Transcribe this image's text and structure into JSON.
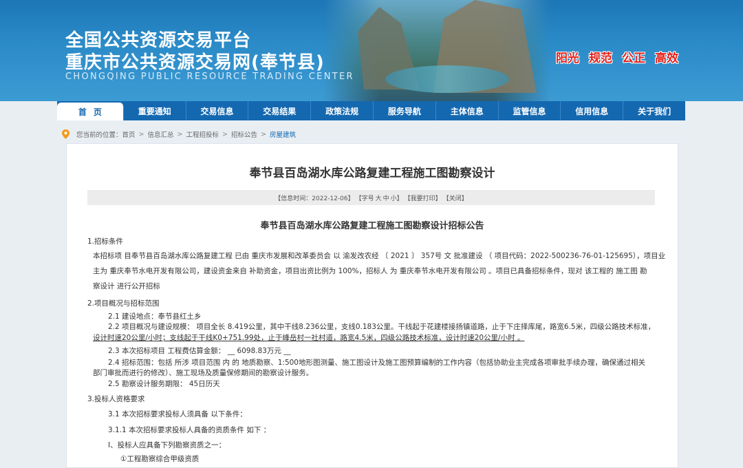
{
  "header": {
    "title_line1": "全国公共资源交易平台",
    "title_line2": "重庆市公共资源交易网(奉节县)",
    "title_en": "CHONGQING PUBLIC RESOURCE TRADING CENTER",
    "slogans": [
      "阳光",
      "规范",
      "公正",
      "高效"
    ],
    "slogan_color": "#e4201b"
  },
  "nav": {
    "items": [
      "首页",
      "重要通知",
      "交易信息",
      "交易结果",
      "政策法规",
      "服务导航",
      "主体信息",
      "监管信息",
      "信用信息",
      "关于我们"
    ],
    "active": "首页",
    "bg_color": "#1468b0"
  },
  "breadcrumb": {
    "prefix": "您当前的位置：",
    "items": [
      "首页",
      "信息汇总",
      "工程招投标",
      "招标公告"
    ],
    "current": "房屋建筑",
    "sep": ">"
  },
  "article": {
    "title": "奉节县百岛湖水库公路复建工程施工图勘察设计",
    "info": {
      "date": "【信息时间：2022-12-06】",
      "font_size_label": "【字号",
      "size_large": "大",
      "size_medium": "中",
      "size_small": "小】",
      "print": "【我要打印】",
      "close": "【关闭】"
    },
    "notice_title": "奉节县百岛湖水库公路复建工程施工图勘察设计招标公告",
    "lines": [
      "1.招标条件",
      "本招标项 目奉节县百岛湖水库公路复建工程 已由 重庆市发展和改革委员会 以 渝发改农经 〔 2021 〕 357号 文 批准建设 （ 项目代码：2022-500236-76-01-125695），项目业",
      "主为 重庆奉节水电开发有限公司，建设资金来自 补助资金，项目出资比例为 100%，招标人 为 重庆奉节水电开发有限公司 。项目已具备招标条件，现对 该工程的 施工图 勘",
      "察设计 进行公开招标",
      "2.项目概况与招标范围",
      "2.1 建设地点：奉节县红土乡",
      "2.2 项目概况与建设规模： 项目全长 8.419公里，其中干线8.236公里，支线0.183公里。干线起于花建楼接扬镇道路，止于下庄择库尾，路宽6.5米，四级公路技术标准，",
      "设计时速20公里/小时；支线起于干线K0+751.99处，止于峰岳村一社村道，路宽4.5米，四级公路技术标准，设计时速20公里/小时 。",
      "2.3 本次招标项目 工程费估算金额：  __ 6098.83万元 __",
      "2.4 招标范围：包括 所涉 项目范围 内 的 地质勘察、1:500地形图测量、施工图设计及施工图预算编制的工作内容（包括协助业主完成各项审批手续办理，确保通过相关",
      "部门审批而进行的修改）、施工现场及质量保修期间的勘察设计服务。",
      "2.5 勘察设计服务期限： 45日历天",
      "3.投标人资格要求",
      "3.1   本次招标要求投标人须具备 以下条件：",
      "3.1.1 本次招标要求投标人具备的资质条件 如下 ：",
      "I、投标人应具备下列勘察资质之一：",
      "①工程勘察综合甲级资质"
    ]
  }
}
